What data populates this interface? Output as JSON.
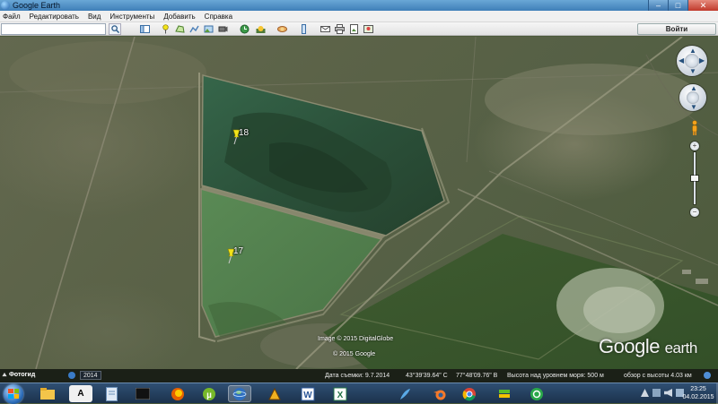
{
  "window": {
    "title": "Google Earth",
    "controls": [
      "–",
      "□",
      "✕"
    ]
  },
  "menu": {
    "items": [
      "Файл",
      "Редактировать",
      "Вид",
      "Инструменты",
      "Добавить",
      "Справка"
    ]
  },
  "toolbar": {
    "search_value": "",
    "signin_label": "Войти",
    "icons": [
      "sidebar-toggle-icon",
      "placemark-icon",
      "polygon-icon",
      "path-icon",
      "image-overlay-icon",
      "record-tour-icon",
      "historical-imagery-icon",
      "sunlight-icon",
      "planets-icon",
      "ruler-icon",
      "email-icon",
      "print-icon",
      "save-image-icon",
      "maps-icon"
    ]
  },
  "map": {
    "placemarks": [
      {
        "label": "18"
      },
      {
        "label": "17"
      }
    ],
    "credits": {
      "line1": "Image © 2015 DigitalGlobe",
      "line2": "© 2015 Google"
    },
    "logo": {
      "word1": "Google",
      "word2": "earth"
    }
  },
  "statusbar": {
    "tour_label": "Фотогид",
    "year": "2014",
    "imagery_date": "Дата съемки: 9.7.2014",
    "lat": "43°39'39.64\" С",
    "lon": "77°48'09.76\" В",
    "elevation": "Высота над уровнем моря:   500 м",
    "eye_alt": "обзор с высоты  4.03 км"
  },
  "taskbar": {
    "apps": [
      "file-explorer",
      "font-viewer",
      "notepad",
      "cmd",
      "firefox",
      "utorrent",
      "google-earth",
      "winamp",
      "word",
      "excel",
      "feather-app",
      "blender",
      "chrome",
      "bluestacks",
      "qip"
    ],
    "active_app": "google-earth",
    "time": "23:25",
    "date": "04.02.2015"
  },
  "colors": {
    "accent": "#3f7fb8",
    "placemark": "#f2e41a",
    "water_north": "#2e5a3d",
    "water_south": "#4f7a4a"
  }
}
